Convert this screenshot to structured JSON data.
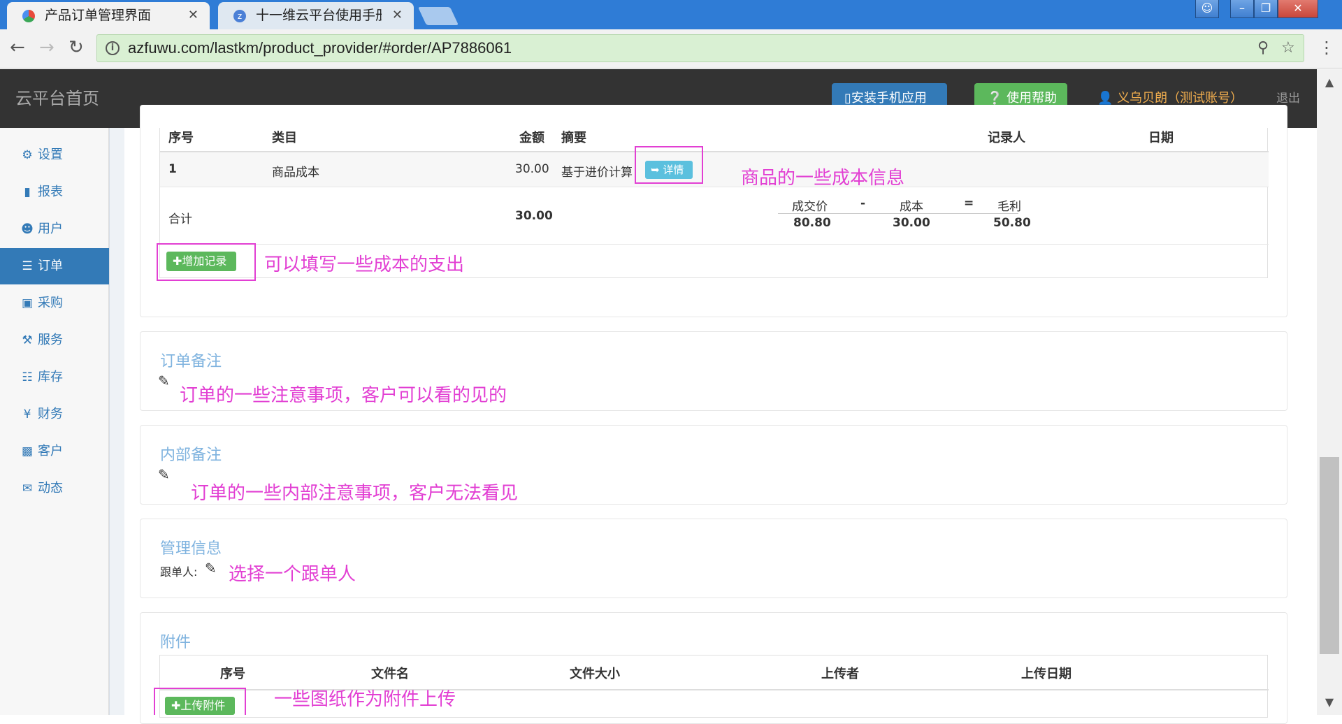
{
  "browser": {
    "tabs": [
      {
        "title": "产品订单管理界面",
        "active": true
      },
      {
        "title": "十一维云平台使用手册 -",
        "active": false
      }
    ],
    "url": "azfuwu.com/lastkm/product_provider/#order/AP7886061"
  },
  "header": {
    "brand": "云平台首页",
    "mobile_button": "安装手机应用",
    "help_button": "使用帮助",
    "user": "义乌贝朗（测试账号）",
    "logout": "退出"
  },
  "sidebar": {
    "items": [
      {
        "label": "设置",
        "icon": "gear-icon"
      },
      {
        "label": "报表",
        "icon": "bar-chart-icon"
      },
      {
        "label": "用户",
        "icon": "user-icon"
      },
      {
        "label": "订单",
        "icon": "list-icon",
        "active": true
      },
      {
        "label": "采购",
        "icon": "cart-icon"
      },
      {
        "label": "服务",
        "icon": "wrench-icon"
      },
      {
        "label": "库存",
        "icon": "barcode-icon"
      },
      {
        "label": "财务",
        "icon": "yen-icon"
      },
      {
        "label": "客户",
        "icon": "briefcase-icon"
      },
      {
        "label": "动态",
        "icon": "comment-icon"
      }
    ]
  },
  "cost_table": {
    "headers": [
      "序号",
      "类目",
      "金额",
      "摘要",
      "记录人",
      "日期"
    ],
    "row": {
      "index": "1",
      "category": "商品成本",
      "amount": "30.00",
      "summary": "基于进价计算",
      "detail_button": "详情"
    },
    "total_label": "合计",
    "total_amount": "30.00",
    "profit": {
      "deal_label": "成交价",
      "minus": "-",
      "cost_label": "成本",
      "equals": "=",
      "profit_label": "毛利",
      "deal_value": "80.80",
      "cost_value": "30.00",
      "profit_value": "50.80"
    },
    "add_button": "增加记录"
  },
  "sections": {
    "order_note_title": "订单备注",
    "internal_note_title": "内部备注",
    "management_title": "管理信息",
    "follower_label": "跟单人:",
    "attachments_title": "附件"
  },
  "attachments_table": {
    "headers": [
      "序号",
      "文件名",
      "文件大小",
      "上传者",
      "上传日期"
    ],
    "upload_button": "上传附件"
  },
  "annotations": {
    "cost_info": "商品的一些成本信息",
    "add_expense": "可以填写一些成本的支出",
    "order_note": "订单的一些注意事项，客户可以看的见的",
    "internal_note": "订单的一些内部注意事项，客户无法看见",
    "follower": "选择一个跟单人",
    "attachment": "一些图纸作为附件上传"
  },
  "colors": {
    "annotation": "#e23fd3",
    "primary": "#337ab7",
    "success": "#5cb85c",
    "info": "#5bc0de",
    "header_bg": "#333333"
  }
}
